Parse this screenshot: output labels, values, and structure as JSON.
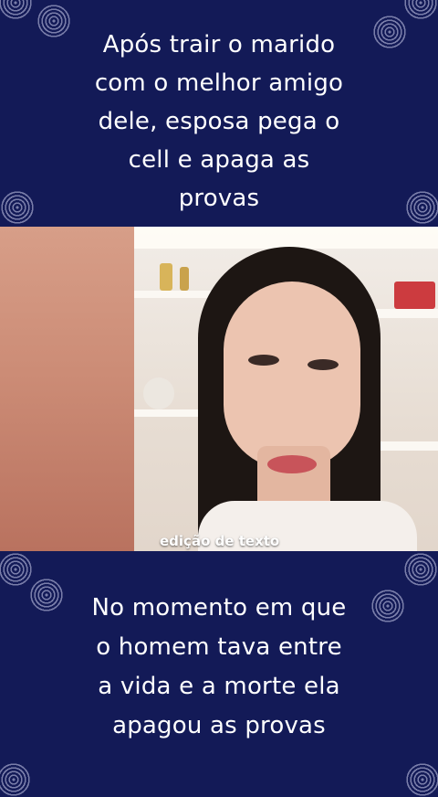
{
  "top_caption": {
    "lines": [
      "Após trair o marido",
      "com o melhor amigo",
      "dele, esposa pega o",
      "cell e apaga as",
      "provas"
    ]
  },
  "photo": {
    "watermark": "edição de texto"
  },
  "bottom_caption": {
    "lines": [
      "No momento em que",
      "o homem tava entre",
      "a vida e a morte ela",
      "apagou as provas"
    ]
  },
  "colors": {
    "background": "#131a57",
    "text": "#ffffff"
  }
}
